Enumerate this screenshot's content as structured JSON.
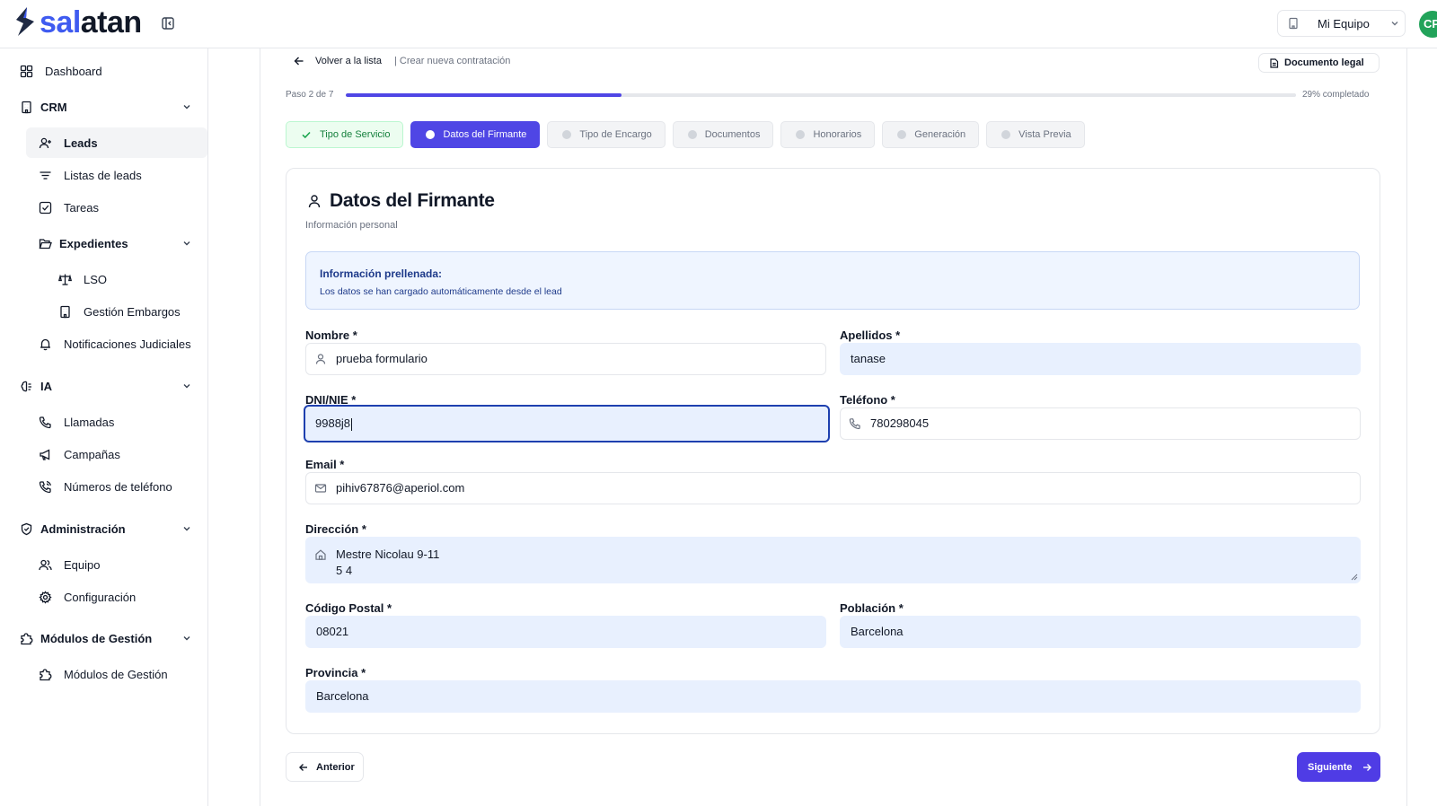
{
  "brand": {
    "name_part1": "sal",
    "name_part2": "atan",
    "accent": "#3f5bf0"
  },
  "topbar": {
    "team_label": "Mi Equipo",
    "avatar_initials": "CP"
  },
  "sidebar": {
    "dashboard": "Dashboard",
    "crm": "CRM",
    "leads": "Leads",
    "lead_lists": "Listas de leads",
    "tasks": "Tareas",
    "expedientes": "Expedientes",
    "lso": "LSO",
    "embargos": "Gestión Embargos",
    "judicial": "Notificaciones Judiciales",
    "ia": "IA",
    "calls": "Llamadas",
    "campaigns": "Campañas",
    "phone_numbers": "Números de teléfono",
    "admin": "Administración",
    "team": "Equipo",
    "config": "Configuración",
    "modules_group": "Módulos de Gestión",
    "modules": "Módulos de Gestión"
  },
  "header": {
    "back": "Volver a la lista",
    "breadcrumb": "| Crear nueva contratación",
    "doc_button": "Documento legal"
  },
  "progress": {
    "step_label": "Paso 2 de 7",
    "percent": 29,
    "percent_label": "29% completado"
  },
  "steps": [
    {
      "label": "Tipo de Servicio",
      "state": "done"
    },
    {
      "label": "Datos del Firmante",
      "state": "current"
    },
    {
      "label": "Tipo de Encargo",
      "state": "pending"
    },
    {
      "label": "Documentos",
      "state": "pending"
    },
    {
      "label": "Honorarios",
      "state": "pending"
    },
    {
      "label": "Generación",
      "state": "pending"
    },
    {
      "label": "Vista Previa",
      "state": "pending"
    }
  ],
  "form": {
    "title": "Datos del Firmante",
    "subtitle": "Información personal",
    "info_title": "Información prellenada:",
    "info_text": "Los datos se han cargado automáticamente desde el lead",
    "nombre_label": "Nombre *",
    "nombre_value": "prueba formulario",
    "apellidos_label": "Apellidos *",
    "apellidos_value": "tanase",
    "dni_label": "DNI/NIE *",
    "dni_value": "9988j8",
    "telefono_label": "Teléfono *",
    "telefono_value": "780298045",
    "email_label": "Email *",
    "email_value": "pihiv67876@aperiol.com",
    "direccion_label": "Dirección *",
    "direccion_value": "Mestre Nicolau 9-11\n5 4",
    "cp_label": "Código Postal *",
    "cp_value": "08021",
    "poblacion_label": "Población *",
    "poblacion_value": "Barcelona",
    "provincia_label": "Provincia *",
    "provincia_value": "Barcelona"
  },
  "footer": {
    "prev": "Anterior",
    "next": "Siguiente"
  }
}
